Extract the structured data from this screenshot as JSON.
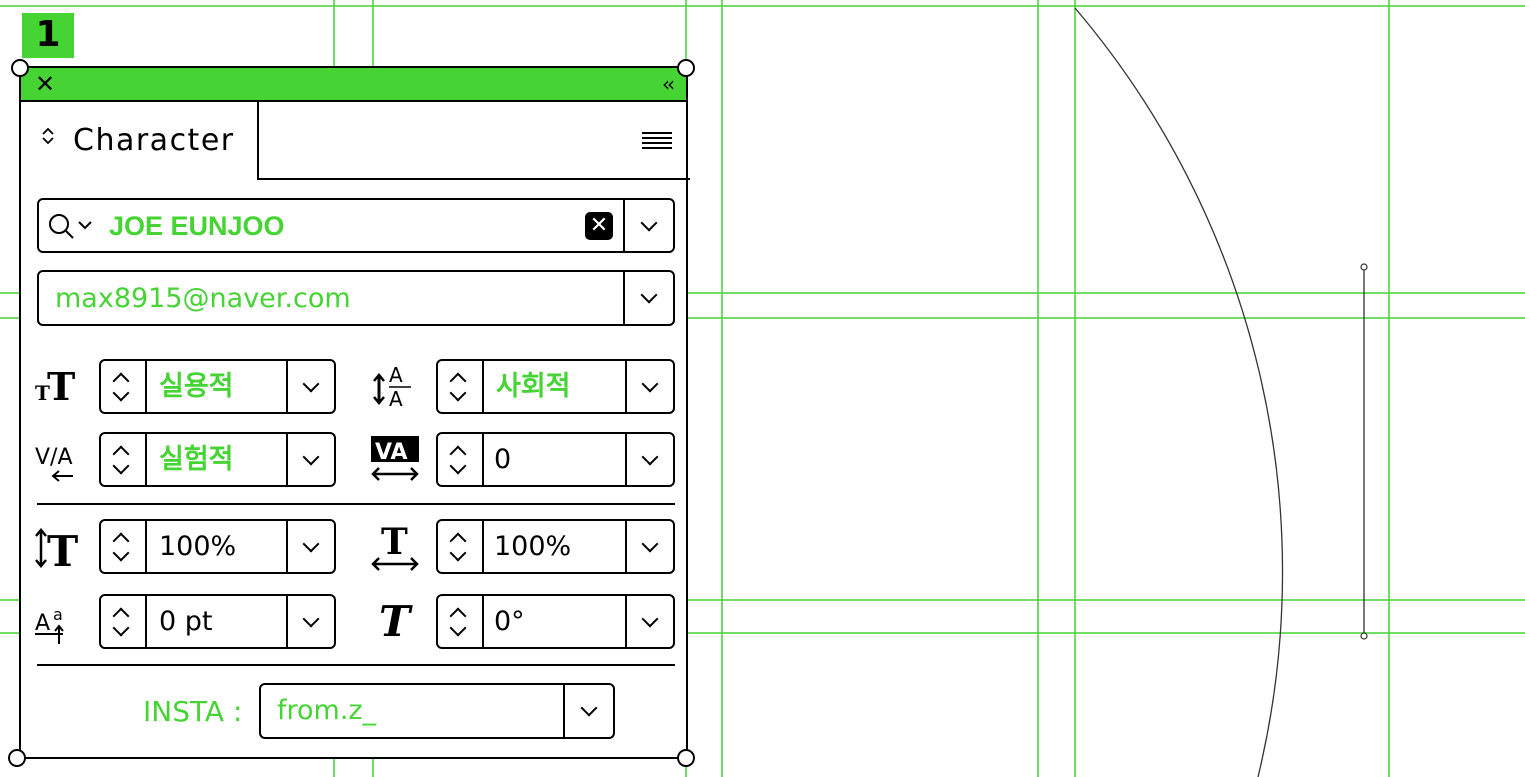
{
  "badge": {
    "label": "1"
  },
  "panel": {
    "close_icon": "close-icon",
    "collapse_icon": "double-chevron-left-icon",
    "tab": {
      "icon": "expand-collapse-icon",
      "label": "Character"
    },
    "menu_icon": "hamburger-menu-icon",
    "font_family": {
      "value": "JOE EUNJOO"
    },
    "font_style": {
      "value": "max8915@naver.com"
    },
    "font_size": {
      "value": "실용적"
    },
    "leading": {
      "value": "사회적"
    },
    "kerning": {
      "value": "실험적"
    },
    "tracking": {
      "value": "0"
    },
    "vertical_scale": {
      "value": "100%"
    },
    "horizontal_scale": {
      "value": "100%"
    },
    "baseline_shift": {
      "value": "0 pt"
    },
    "rotation": {
      "value": "0°"
    },
    "insta": {
      "label": "INSTA :",
      "value": "from.z_"
    }
  },
  "colors": {
    "accent": "#45d434",
    "ink": "#000000",
    "background": "#ffffff"
  }
}
